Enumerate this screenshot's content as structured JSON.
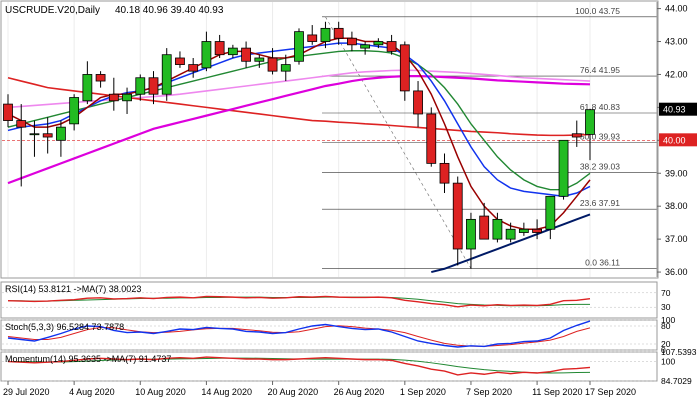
{
  "chart_data": {
    "type": "candlestick",
    "title": "USCRUDE.V20,Daily",
    "ohlc_header": "40.18 40.96 39.40 40.93",
    "x_labels": [
      "29 Jul 2020",
      "4 Aug 2020",
      "10 Aug 2020",
      "14 Aug 2020",
      "20 Aug 2020",
      "26 Aug 2020",
      "1 Sep 2020",
      "7 Sep 2020",
      "11 Sep 2020",
      "17 Sep 2020"
    ],
    "x_label_index": [
      0,
      5,
      10,
      15,
      20,
      25,
      30,
      35,
      40,
      44
    ],
    "y_ticks": [
      36.0,
      37.0,
      38.0,
      39.0,
      40.0,
      41.0,
      42.0,
      43.0,
      44.0
    ],
    "ylim": [
      35.85,
      44.2
    ],
    "candles": [
      [
        41.1,
        41.4,
        40.4,
        40.6
      ],
      [
        40.6,
        41.1,
        38.6,
        40.4
      ],
      [
        40.2,
        40.6,
        39.5,
        40.2
      ],
      [
        40.2,
        40.7,
        39.6,
        40.1
      ],
      [
        40.0,
        40.6,
        39.5,
        40.4
      ],
      [
        40.5,
        41.4,
        40.3,
        41.3
      ],
      [
        41.2,
        42.4,
        41.1,
        42.0
      ],
      [
        42.0,
        42.1,
        41.6,
        41.8
      ],
      [
        41.4,
        41.9,
        40.9,
        41.2
      ],
      [
        41.2,
        41.6,
        40.8,
        41.4
      ],
      [
        41.4,
        42.0,
        41.2,
        41.9
      ],
      [
        41.9,
        42.1,
        41.1,
        41.4
      ],
      [
        41.4,
        42.8,
        41.2,
        42.6
      ],
      [
        42.5,
        42.7,
        42.2,
        42.3
      ],
      [
        42.3,
        42.5,
        41.9,
        42.1
      ],
      [
        42.2,
        43.3,
        42.1,
        43.0
      ],
      [
        43.0,
        43.2,
        42.5,
        42.6
      ],
      [
        42.6,
        42.9,
        42.5,
        42.8
      ],
      [
        42.8,
        43.0,
        42.2,
        42.4
      ],
      [
        42.4,
        42.6,
        42.2,
        42.5
      ],
      [
        42.5,
        42.8,
        42.0,
        42.1
      ],
      [
        42.1,
        42.6,
        41.8,
        42.3
      ],
      [
        42.4,
        43.4,
        42.3,
        43.3
      ],
      [
        43.2,
        43.5,
        42.9,
        43.0
      ],
      [
        43.0,
        43.6,
        42.8,
        43.4
      ],
      [
        43.4,
        43.6,
        42.9,
        43.1
      ],
      [
        43.1,
        43.3,
        42.7,
        42.9
      ],
      [
        42.8,
        43.0,
        42.6,
        42.9
      ],
      [
        42.9,
        43.1,
        42.8,
        43.0
      ],
      [
        43.0,
        43.2,
        42.6,
        42.7
      ],
      [
        42.9,
        43.0,
        41.2,
        41.5
      ],
      [
        41.5,
        41.8,
        40.4,
        40.8
      ],
      [
        40.8,
        41.0,
        39.2,
        39.3
      ],
      [
        39.3,
        39.6,
        38.4,
        38.7
      ],
      [
        38.7,
        38.9,
        36.2,
        36.7
      ],
      [
        36.7,
        37.8,
        36.1,
        37.6
      ],
      [
        37.7,
        38.1,
        37.0,
        37.0
      ],
      [
        37.0,
        37.8,
        36.9,
        37.6
      ],
      [
        37.0,
        37.5,
        36.9,
        37.3
      ],
      [
        37.2,
        37.5,
        37.1,
        37.3
      ],
      [
        37.3,
        37.6,
        37.0,
        37.2
      ],
      [
        37.3,
        37.9,
        37.0,
        38.3
      ],
      [
        38.3,
        39.9,
        38.2,
        40.0
      ],
      [
        40.2,
        40.6,
        39.8,
        40.1
      ],
      [
        40.18,
        40.96,
        39.4,
        40.93
      ]
    ],
    "fib_levels": [
      {
        "label": "100.0 43.75",
        "value": 43.75
      },
      {
        "label": "76.4 41.95",
        "value": 41.95
      },
      {
        "label": "61.8 40.83",
        "value": 40.83
      },
      {
        "label": "50.0 39.93",
        "value": 39.93
      },
      {
        "label": "38.2 39.03",
        "value": 39.03
      },
      {
        "label": "23.6 37.91",
        "value": 37.91
      },
      {
        "label": "0.0 36.11",
        "value": 36.11
      }
    ],
    "current_price_label": "40.93",
    "horizontal_level_label": "40.00",
    "moving_averages": {
      "red": [
        41.9,
        41.8,
        41.7,
        41.6,
        41.55,
        41.5,
        41.45,
        41.4,
        41.35,
        41.3,
        41.25,
        41.2,
        41.15,
        41.1,
        41.05,
        41.0,
        40.95,
        40.9,
        40.85,
        40.8,
        40.75,
        40.7,
        40.65,
        40.6,
        40.58,
        40.55,
        40.53,
        40.5,
        40.48,
        40.45,
        40.42,
        40.39,
        40.36,
        40.33,
        40.3,
        40.27,
        40.25,
        40.23,
        40.2,
        40.18,
        40.16,
        40.15,
        40.15,
        40.16,
        40.18
      ],
      "magenta": [
        38.7,
        38.85,
        39.0,
        39.15,
        39.3,
        39.45,
        39.6,
        39.75,
        39.9,
        40.05,
        40.2,
        40.35,
        40.45,
        40.55,
        40.65,
        40.75,
        40.85,
        40.95,
        41.05,
        41.15,
        41.25,
        41.35,
        41.45,
        41.55,
        41.65,
        41.72,
        41.8,
        41.86,
        41.9,
        41.93,
        41.95,
        41.95,
        41.94,
        41.92,
        41.9,
        41.88,
        41.85,
        41.82,
        41.8,
        41.78,
        41.76,
        41.74,
        41.72,
        41.71,
        41.7
      ],
      "pink": [
        41.0,
        41.03,
        41.06,
        41.09,
        41.12,
        41.15,
        41.18,
        41.21,
        41.24,
        41.27,
        41.3,
        41.33,
        41.36,
        41.4,
        41.45,
        41.5,
        41.55,
        41.6,
        41.65,
        41.7,
        41.75,
        41.8,
        41.85,
        41.9,
        41.95,
        42.0,
        42.05,
        42.08,
        42.1,
        42.12,
        42.13,
        42.12,
        42.1,
        42.08,
        42.06,
        42.03,
        42.0,
        41.97,
        41.93,
        41.9,
        41.88,
        41.86,
        41.84,
        41.82,
        41.8
      ],
      "blue": [
        40.3,
        40.4,
        40.45,
        40.5,
        40.6,
        40.8,
        41.0,
        41.2,
        41.35,
        41.45,
        41.5,
        41.6,
        41.75,
        41.9,
        42.05,
        42.2,
        42.35,
        42.5,
        42.6,
        42.65,
        42.7,
        42.75,
        42.8,
        42.85,
        42.9,
        42.95,
        42.95,
        42.9,
        42.85,
        42.8,
        42.6,
        42.3,
        41.8,
        41.2,
        40.5,
        39.8,
        39.2,
        38.8,
        38.55,
        38.45,
        38.4,
        38.35,
        38.3,
        38.4,
        38.6
      ],
      "green": [
        40.4,
        40.5,
        40.6,
        40.7,
        40.8,
        40.9,
        41.0,
        41.1,
        41.2,
        41.3,
        41.4,
        41.5,
        41.6,
        41.7,
        41.8,
        41.9,
        42.0,
        42.1,
        42.2,
        42.3,
        42.4,
        42.5,
        42.55,
        42.6,
        42.65,
        42.7,
        42.72,
        42.72,
        42.7,
        42.65,
        42.5,
        42.3,
        42.0,
        41.6,
        41.1,
        40.5,
        40.0,
        39.5,
        39.1,
        38.8,
        38.6,
        38.5,
        38.5,
        38.7,
        39.0
      ],
      "maroon": [
        40.8,
        40.6,
        40.4,
        40.4,
        40.5,
        40.7,
        41.0,
        41.3,
        41.4,
        41.4,
        41.5,
        41.6,
        41.8,
        42.0,
        42.2,
        42.4,
        42.6,
        42.7,
        42.7,
        42.6,
        42.5,
        42.5,
        42.6,
        42.8,
        43.0,
        43.1,
        43.1,
        43.0,
        43.0,
        42.9,
        42.6,
        42.1,
        41.4,
        40.5,
        39.5,
        38.6,
        38.0,
        37.6,
        37.4,
        37.3,
        37.3,
        37.4,
        37.8,
        38.3,
        38.8
      ],
      "navy_trend": [
        36.0,
        36.1,
        36.25,
        36.4,
        36.55,
        36.7,
        36.85,
        37.0,
        37.15,
        37.3,
        37.45,
        37.6,
        37.75
      ]
    },
    "indicators": [
      {
        "label": "RSI(14) 53.8121 ->MA(7) 38.0023",
        "axis": [
          "70",
          "30"
        ],
        "values": [
          48,
          47,
          46,
          47,
          49,
          51,
          55,
          56,
          53,
          54,
          56,
          54,
          57,
          58,
          56,
          60,
          59,
          58,
          56,
          57,
          55,
          56,
          59,
          58,
          60,
          58,
          57,
          57,
          58,
          56,
          49,
          45,
          40,
          37,
          31,
          36,
          34,
          37,
          35,
          36,
          35,
          38,
          48,
          49,
          53.8
        ],
        "signal": [
          48,
          48,
          47,
          47,
          48,
          49,
          50,
          51,
          52,
          53,
          54,
          55,
          55,
          56,
          56,
          57,
          57,
          58,
          58,
          58,
          57,
          57,
          57,
          57,
          58,
          58,
          58,
          58,
          58,
          57,
          55,
          52,
          48,
          44,
          40,
          38,
          36,
          35,
          34,
          34,
          34,
          35,
          37,
          38,
          38
        ]
      },
      {
        "label": "Stoch(5,3,3) 96.5284 73.7878",
        "axis": [
          "100",
          "80",
          "20",
          "0"
        ],
        "values": [
          40,
          35,
          30,
          42,
          55,
          70,
          80,
          78,
          65,
          58,
          60,
          55,
          62,
          70,
          68,
          75,
          72,
          70,
          62,
          60,
          55,
          58,
          70,
          80,
          85,
          78,
          72,
          68,
          70,
          60,
          45,
          30,
          22,
          15,
          10,
          14,
          12,
          20,
          22,
          28,
          30,
          40,
          65,
          82,
          96.5
        ],
        "signal": [
          45,
          40,
          35,
          35,
          42,
          55,
          68,
          75,
          74,
          67,
          61,
          58,
          59,
          62,
          67,
          71,
          72,
          72,
          68,
          64,
          59,
          58,
          61,
          69,
          78,
          81,
          78,
          73,
          70,
          66,
          58,
          45,
          33,
          22,
          16,
          13,
          12,
          15,
          18,
          23,
          27,
          33,
          45,
          62,
          73.8
        ]
      },
      {
        "label": "Momentum(14) 95.3635 ->MA(7) 91.4737",
        "axis": [
          "107.5393",
          "100",
          "84.7029"
        ],
        "values": [
          100,
          99.5,
          99,
          99.5,
          100,
          101,
          102,
          102.5,
          102,
          101.5,
          102,
          101.5,
          102.5,
          103,
          102.5,
          103.5,
          103,
          102.5,
          102,
          102,
          101.5,
          101.5,
          102,
          102.5,
          103,
          102.5,
          102,
          101.5,
          101.5,
          101,
          98.5,
          96.5,
          94,
          92.5,
          89.5,
          91,
          90,
          91.5,
          90.5,
          91.5,
          91,
          92,
          94,
          94.5,
          95.4
        ],
        "signal": [
          100,
          100,
          99.8,
          99.6,
          99.6,
          99.9,
          100.3,
          100.8,
          101.2,
          101.5,
          101.7,
          101.8,
          101.9,
          102.1,
          102.2,
          102.4,
          102.6,
          102.7,
          102.7,
          102.6,
          102.4,
          102.2,
          102,
          101.9,
          101.9,
          101.9,
          101.9,
          101.9,
          101.9,
          101.7,
          101.1,
          100.2,
          99,
          97.6,
          96,
          94.7,
          93.6,
          92.8,
          92.3,
          91.6,
          91.1,
          91,
          91.1,
          91.4,
          91.5
        ]
      }
    ]
  },
  "colors": {
    "bull": "#22bb22",
    "bear": "#dd2222",
    "red_ma": "#dd2222",
    "magenta_ma": "#dd00dd",
    "pink_ma": "#ee88ee",
    "blue_ma": "#1133ee",
    "green_ma": "#228833",
    "maroon_ma": "#990000",
    "navy_trend": "#001a66",
    "fib": "#333333",
    "price_box": "#dd2222",
    "envelope": "#88cc88"
  }
}
